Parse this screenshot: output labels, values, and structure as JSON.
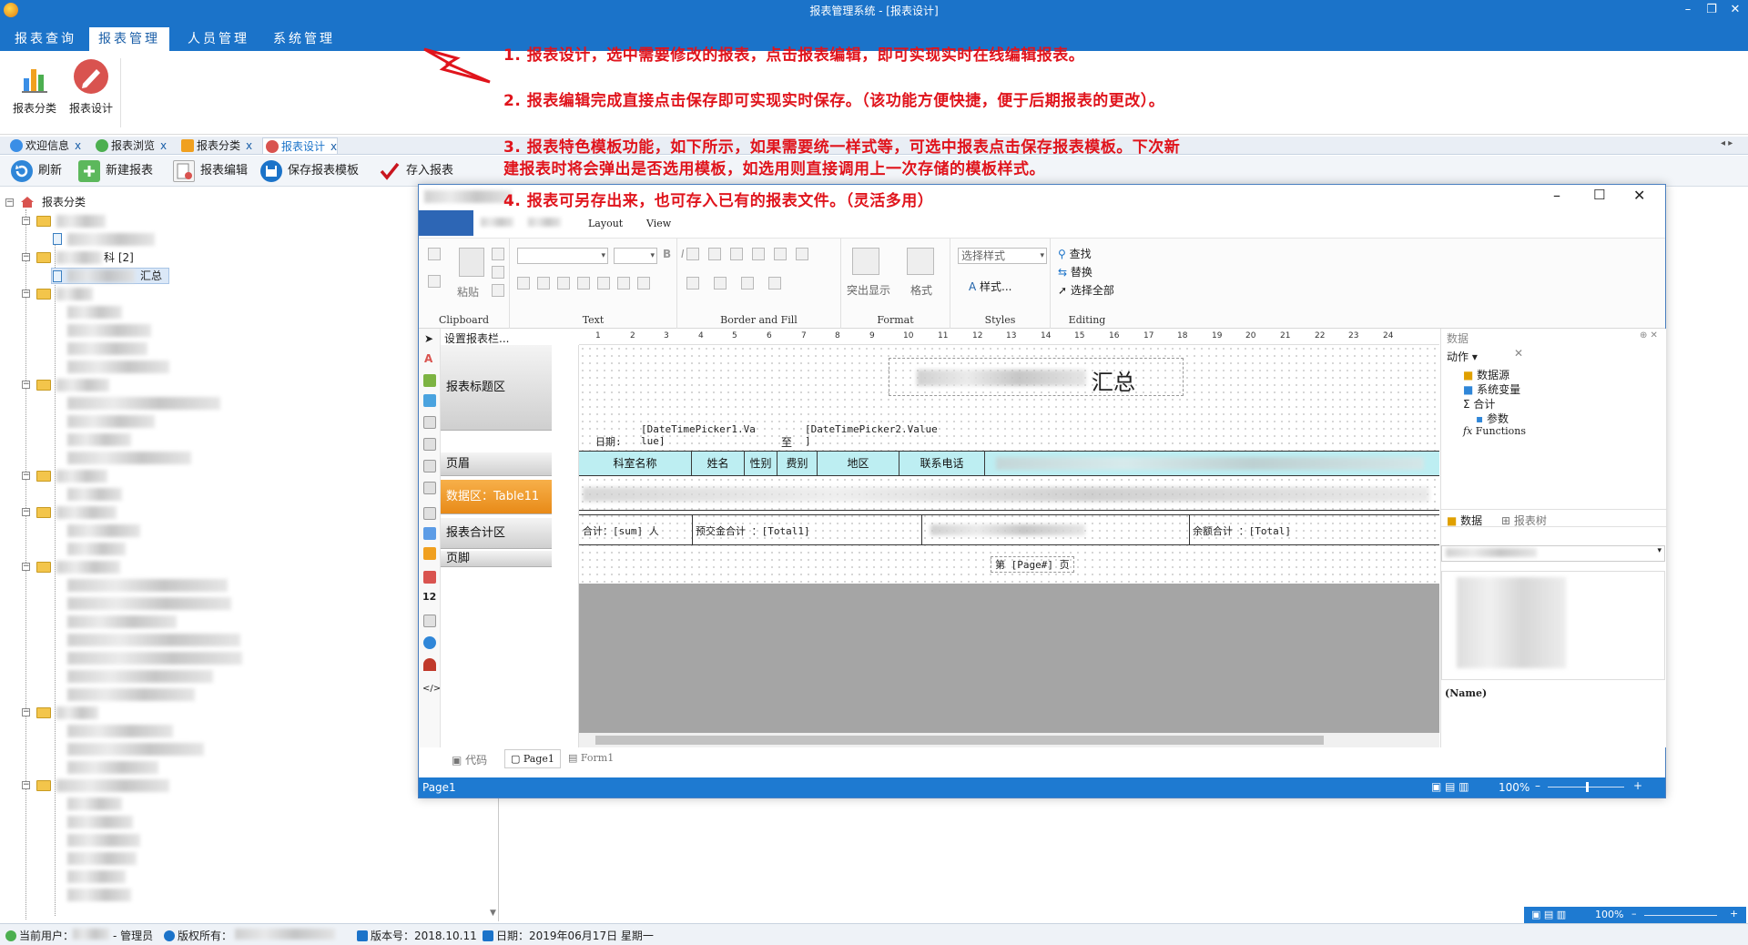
{
  "app": {
    "title": "报表管理系统 - [报表设计]"
  },
  "menu": {
    "tabs": [
      "报表查询",
      "报表管理",
      "人员管理",
      "系统管理"
    ],
    "active": "报表管理"
  },
  "ribbon": {
    "buttons": [
      "报表分类",
      "报表设计"
    ]
  },
  "doc_tabs": [
    {
      "label": "欢迎信息",
      "close": "x"
    },
    {
      "label": "报表浏览",
      "close": "x"
    },
    {
      "label": "报表分类",
      "close": "x"
    },
    {
      "label": "报表设计",
      "close": "x",
      "active": true
    }
  ],
  "toolbar": {
    "refresh": "刷新",
    "new_report": "新建报表",
    "edit_report": "报表编辑",
    "save_template": "保存报表模板",
    "save_report": "存入报表"
  },
  "tree": {
    "root": "报表分类",
    "node_2_suffix": "科 [2]",
    "selected_suffix": "汇总",
    "expander_minus": "−"
  },
  "notes": [
    "1. 报表设计，选中需要修改的报表，点击报表编辑，即可实现实时在线编辑报表。",
    "2. 报表编辑完成直接点击保存即可实现实时保存。（该功能方便快捷，便于后期报表的更改）。",
    "3. 报表特色模板功能，如下所示，如果需要统一样式等，可选中报表点击保存报表模板。下次新",
    "建报表时将会弹出是否选用模板，如选用则直接调用上一次存储的模板样式。",
    "4. 报表可另存出来，也可存入已有的报表文件。（灵活多用）"
  ],
  "designer": {
    "menu": [
      "Layout",
      "View"
    ],
    "groups": [
      "Clipboard",
      "Text",
      "Border and Fill",
      "Format",
      "Styles",
      "Editing"
    ],
    "paste": "粘贴",
    "highlight": "突出显示",
    "format": "格式",
    "style_combo": "选择样式",
    "style_btn": "样式...",
    "find": "查找",
    "replace": "替换",
    "select_all": "选择全部",
    "band_settings": "设置报表栏...",
    "bands": [
      "报表标题区",
      "页眉",
      "数据区：Table11",
      "报表合计区",
      "页脚"
    ],
    "ruler_ticks": [
      "1",
      "2",
      "3",
      "4",
      "5",
      "6",
      "7",
      "8",
      "9",
      "10",
      "11",
      "12",
      "13",
      "14",
      "15",
      "16",
      "17",
      "18",
      "19",
      "20",
      "21",
      "22",
      "23",
      "24"
    ],
    "report_title_suffix": "汇总",
    "date_label": "日期:",
    "date_from": "[DateTimePicker1.Va",
    "date_from2": "lue]",
    "date_to_label": "至",
    "date_to": "[DateTimePicker2.Value",
    "date_to2": "]",
    "columns": [
      "科室名称",
      "姓名",
      "性别",
      "费别",
      "地区",
      "联系电话"
    ],
    "footer_cells": [
      "合计：[sum] 人",
      "预交金合计 ：[Total1]",
      "余额合计 ：[Total]"
    ],
    "page_footer": "第 [Page#] 页",
    "bottom_tabs": [
      "代码",
      "Page1",
      "Form1"
    ],
    "status_page": "Page1",
    "zoom": "100%",
    "right_panel": {
      "header": "数据",
      "actions": "动作",
      "items": [
        "数据源",
        "系统变量",
        "合计",
        "参数",
        "Functions"
      ],
      "tabs": [
        "数据",
        "报表树"
      ],
      "name_label": "(Name)"
    }
  },
  "statusbar": {
    "user_label": "当前用户：",
    "role": "- 管理员",
    "copyright_label": "版权所有：",
    "version": "版本号：2018.10.11",
    "date": "日期：2019年06月17日  星期一",
    "zoom": "100%"
  },
  "colors": {
    "brand": "#1b73c9",
    "note": "#e0141c",
    "band_active": "#f29b2b",
    "header_cyan": "#bdeef2"
  }
}
